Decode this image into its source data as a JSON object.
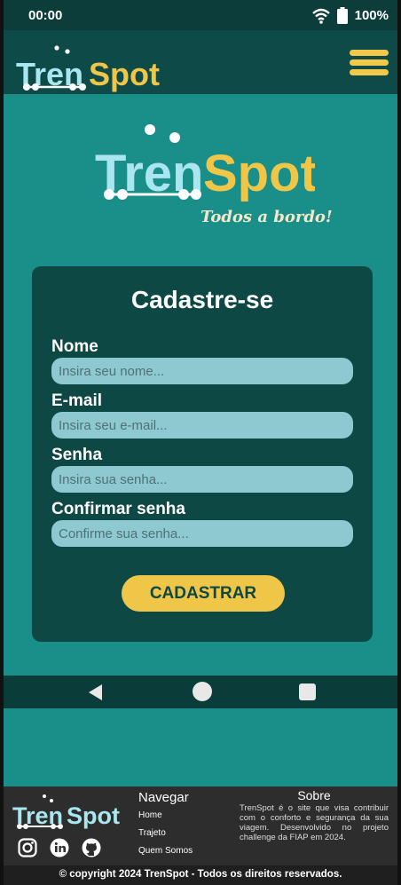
{
  "status_bar": {
    "time": "00:00",
    "battery": "100%",
    "icons": [
      "wifi-icon",
      "battery-icon"
    ]
  },
  "brand": {
    "name_part1": "Tren",
    "name_part2": "Spot",
    "tagline": "Todos a bordo!",
    "colors": {
      "light": "#a9e6ef",
      "yellow": "#efc648",
      "dark": "#0d4845",
      "teal": "#1a8f8a"
    }
  },
  "form": {
    "title": "Cadastre-se",
    "fields": [
      {
        "label": "Nome",
        "placeholder": "Insira seu nome...",
        "value": ""
      },
      {
        "label": "E-mail",
        "placeholder": "Insira seu e-mail...",
        "value": ""
      },
      {
        "label": "Senha",
        "placeholder": "Insira sua senha...",
        "value": ""
      },
      {
        "label": "Confirmar senha",
        "placeholder": "Confirme sua senha...",
        "value": ""
      }
    ],
    "submit_label": "CADASTRAR"
  },
  "footer": {
    "nav_title": "Navegar",
    "links": [
      "Home",
      "Trajeto",
      "Quem Somos"
    ],
    "about_title": "Sobre",
    "about_text": "TrenSpot é o site que visa contribuir com o conforto e segurança da sua viagem. Desenvolvido no projeto challenge da FIAP em 2024.",
    "social": [
      "instagram-icon",
      "linkedin-icon",
      "github-icon"
    ],
    "copyright": "© copyright 2024 TrenSpot - Todos os direitos reservados."
  }
}
